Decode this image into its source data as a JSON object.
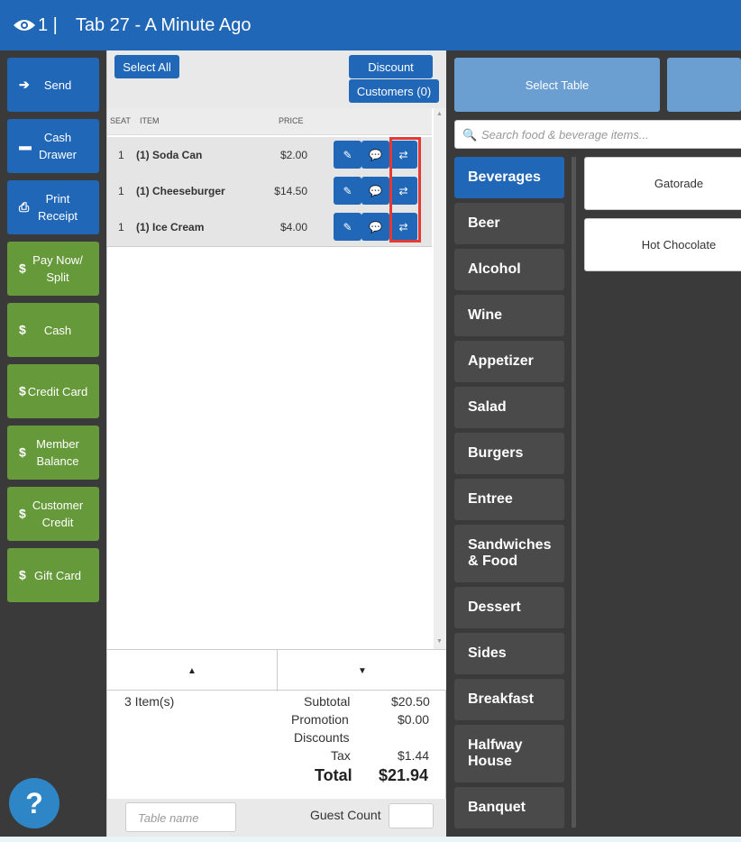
{
  "header": {
    "view_count": "1 |",
    "title": "Tab 27 - A Minute Ago"
  },
  "actions": [
    {
      "label": "Send",
      "icon": "arrow-right-icon",
      "glyph": "➔"
    },
    {
      "label": "Cash\nDrawer",
      "icon": "drawer-icon",
      "glyph": "▬"
    },
    {
      "label": "Print\nReceipt",
      "icon": "printer-icon",
      "glyph": "⎙"
    },
    {
      "label": "Pay Now/\nSplit",
      "icon": "dollar-icon",
      "glyph": "$"
    },
    {
      "label": "Cash",
      "icon": "dollar-icon",
      "glyph": "$"
    },
    {
      "label": "Credit Card",
      "icon": "dollar-icon",
      "glyph": "$"
    },
    {
      "label": "Member\nBalance",
      "icon": "dollar-icon",
      "glyph": "$"
    },
    {
      "label": "Customer\nCredit",
      "icon": "dollar-icon",
      "glyph": "$"
    },
    {
      "label": "Gift Card",
      "icon": "dollar-icon",
      "glyph": "$"
    }
  ],
  "help_label": "?",
  "order": {
    "select_all": "Select All",
    "discount": "Discount",
    "customers": "Customers (0)",
    "columns": {
      "seat": "SEAT",
      "item": "ITEM",
      "price": "PRICE"
    },
    "rows": [
      {
        "seat": "1",
        "item": "(1) Soda Can",
        "price": "$2.00"
      },
      {
        "seat": "1",
        "item": "(1) Cheeseburger",
        "price": "$14.50"
      },
      {
        "seat": "1",
        "item": "(1) Ice Cream",
        "price": "$4.00"
      }
    ],
    "item_count": "3 Item(s)",
    "subtotal_label": "Subtotal",
    "subtotal": "$20.50",
    "promotion_label": "Promotion",
    "promotion": "$0.00",
    "discounts_label": "Discounts",
    "tax_label": "Tax",
    "tax": "$1.44",
    "total_label": "Total",
    "total": "$21.94",
    "table_name_placeholder": "Table name",
    "guest_count_label": "Guest Count"
  },
  "menu": {
    "select_table": "Select Table",
    "search_placeholder": "Search food & beverage items...",
    "categories": [
      "Beverages",
      "Beer",
      "Alcohol",
      "Wine",
      "Appetizer",
      "Salad",
      "Burgers",
      "Entree",
      "Sandwiches & Food",
      "Dessert",
      "Sides",
      "Breakfast",
      "Halfway House",
      "Banquet"
    ],
    "items": [
      "Gatorade",
      "Hot Chocolate"
    ]
  },
  "colors": {
    "primary": "#2167b7",
    "green": "#66993a",
    "highlight": "#e53935"
  }
}
